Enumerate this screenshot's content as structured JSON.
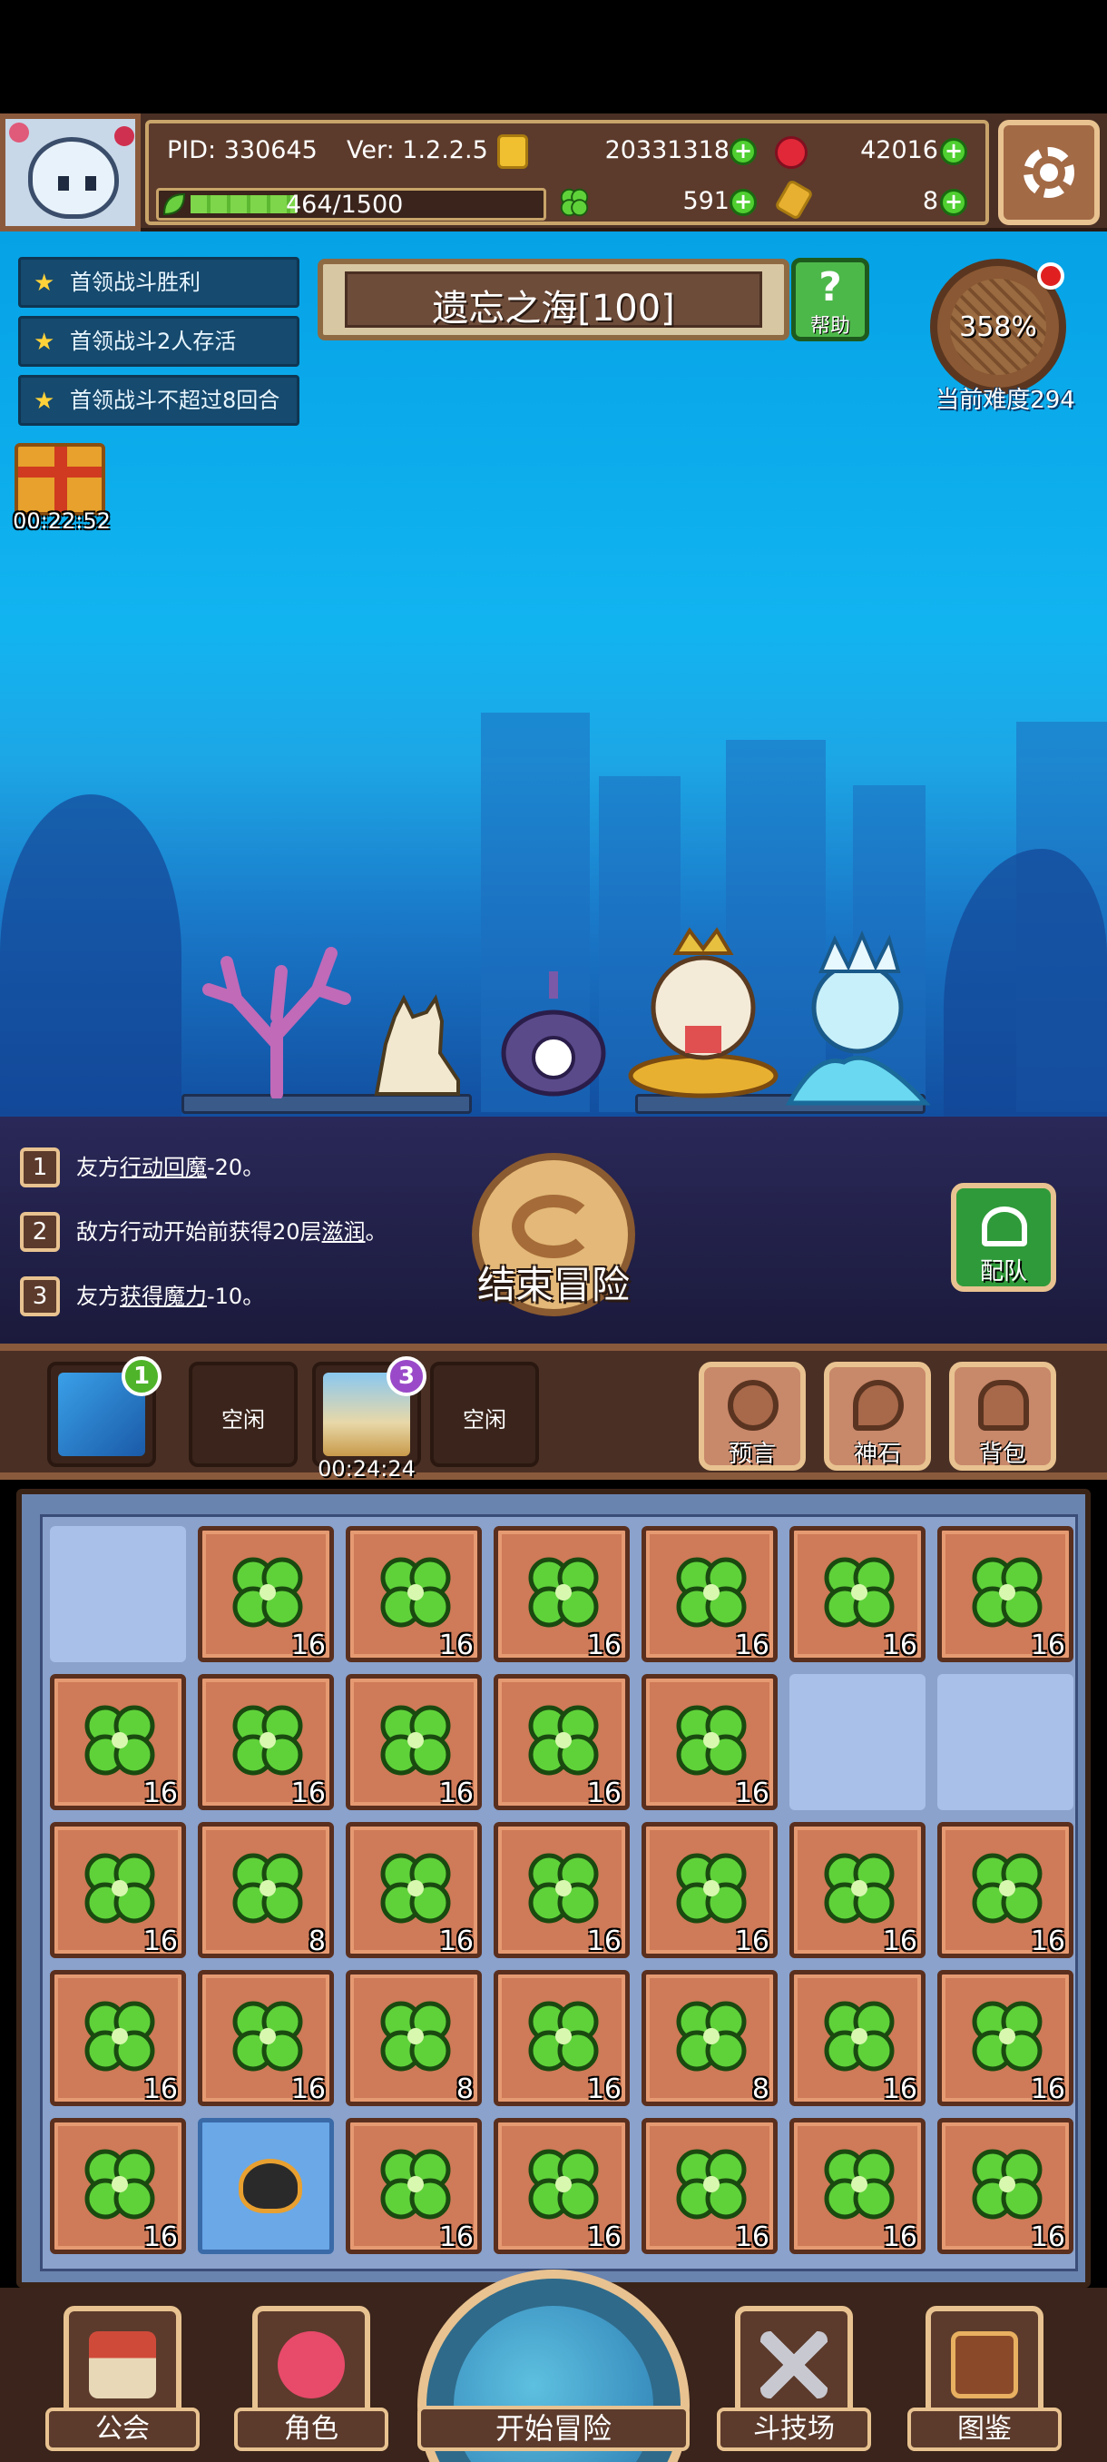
{
  "header": {
    "pid": "PID: 330645",
    "version": "Ver: 1.2.2.5",
    "gold": "20331318",
    "gems": "42016",
    "energy": "464/1500",
    "energy_fraction": 0.309,
    "clovers": "591",
    "keys": "8"
  },
  "quests": [
    {
      "label": "首领战斗胜利"
    },
    {
      "label": "首领战斗2人存活"
    },
    {
      "label": "首领战斗不超过8回合"
    }
  ],
  "gift": {
    "timer": "00:22:52"
  },
  "map": {
    "title": "遗忘之海[100]",
    "help_label": "帮助"
  },
  "difficulty": {
    "percent": "358%",
    "label": "当前难度294"
  },
  "effects": [
    {
      "num": "1",
      "pre": "友方",
      "link": "行动回魔",
      "post": "-20。"
    },
    {
      "num": "2",
      "pre": "敌方行动开始前获得20层",
      "link": "滋润",
      "post": "。"
    },
    {
      "num": "3",
      "pre": "友方",
      "link": "获得魔力",
      "post": "-10。"
    }
  ],
  "end_button": {
    "label": "结束冒险"
  },
  "team_button": {
    "label": "配队"
  },
  "hotbar": {
    "slot1_badge": "1",
    "slot2_label": "空闲",
    "slot3_badge": "3",
    "slot3_timer": "00:24:24",
    "slot4_label": "空闲",
    "menu": [
      {
        "label": "预言",
        "icon": "crystal-ball-icon"
      },
      {
        "label": "神石",
        "icon": "god-stone-icon"
      },
      {
        "label": "背包",
        "icon": "backpack-icon"
      }
    ]
  },
  "inventory": {
    "rows": [
      [
        null,
        "16",
        "16",
        "16",
        "16",
        "16",
        "16"
      ],
      [
        "16",
        "16",
        "16",
        "16",
        "16",
        null,
        null
      ],
      [
        "16",
        "8",
        "16",
        "16",
        "16",
        "16",
        "16"
      ],
      [
        "16",
        "16",
        "8",
        "16",
        "8",
        "16",
        "16"
      ],
      [
        "16",
        "spider",
        "16",
        "16",
        "16",
        "16",
        "16"
      ]
    ]
  },
  "bottom_nav": [
    {
      "label": "公会",
      "icon": "guild-house-icon"
    },
    {
      "label": "角色",
      "icon": "character-icon"
    },
    {
      "label": "开始冒险",
      "icon": "adventure-globe-icon"
    },
    {
      "label": "斗技场",
      "icon": "arena-swords-icon"
    },
    {
      "label": "图鉴",
      "icon": "codex-book-icon"
    }
  ],
  "colors": {
    "sky": "#12b4f0",
    "wood_dark": "#4a2f24",
    "wood_border": "#e8c290",
    "tile": "#cf7a58",
    "clover": "#5fd23a",
    "plus": "#4fcf30"
  }
}
